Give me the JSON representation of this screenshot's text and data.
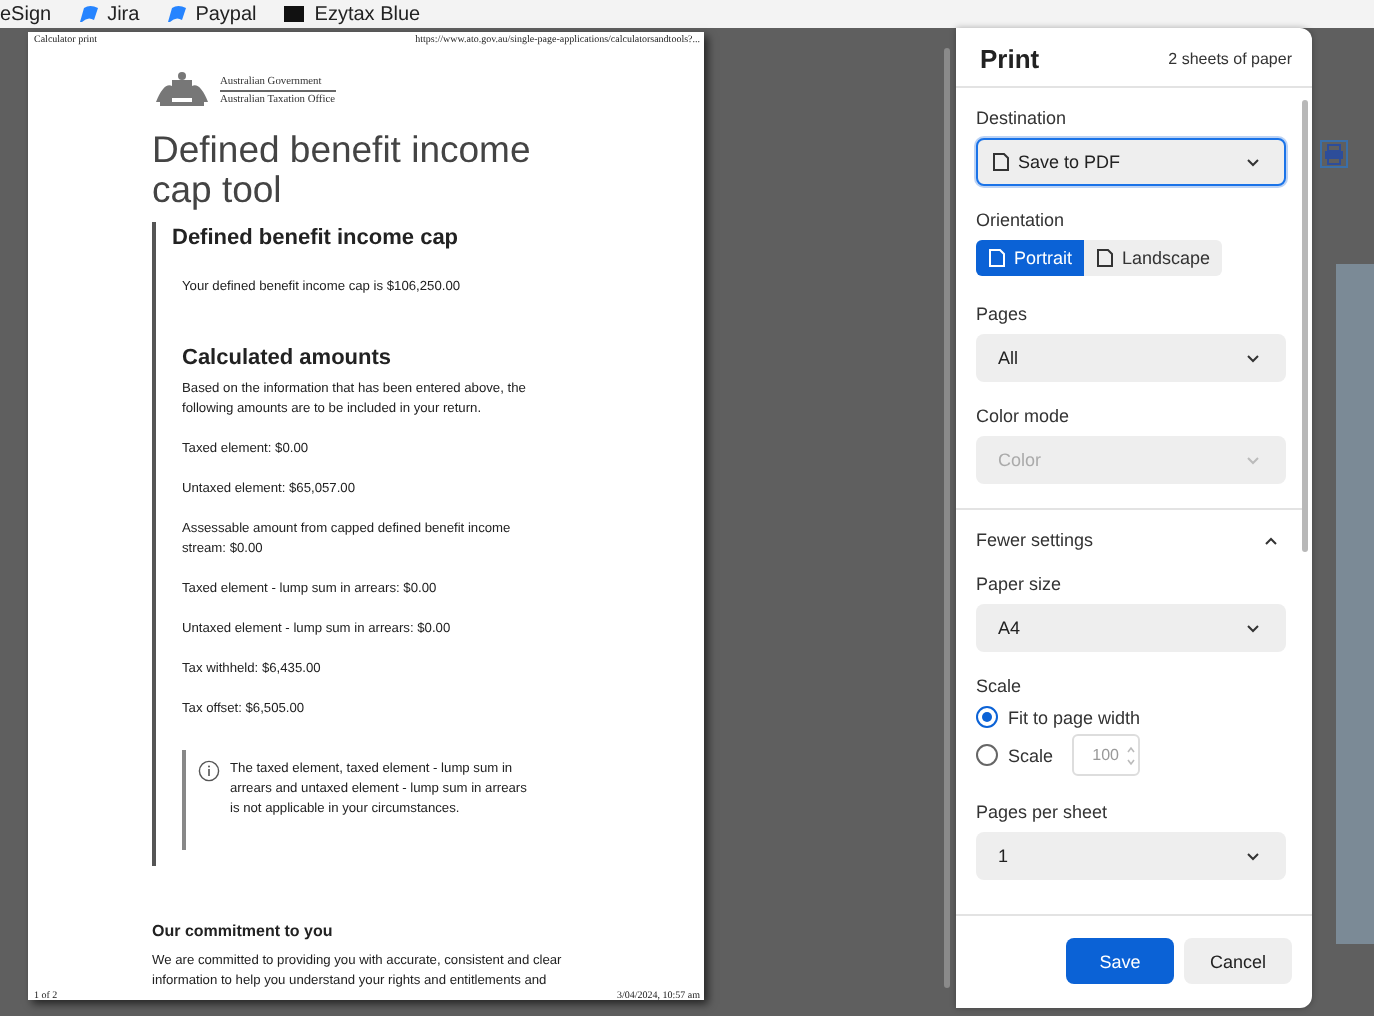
{
  "bookmarks": [
    {
      "label": "eSign",
      "kind": "none"
    },
    {
      "label": "Jira",
      "kind": "flag"
    },
    {
      "label": "Paypal",
      "kind": "flag"
    },
    {
      "label": "Ezytax Blue",
      "kind": "block"
    }
  ],
  "preview": {
    "header_left": "Calculator print",
    "header_right": "https://www.ato.gov.au/single-page-applications/calculatorsandtools?...",
    "logo_lines": [
      "Australian Government",
      "Australian Taxation Office"
    ],
    "title": "Defined benefit income cap tool",
    "section_heading": "Defined benefit income cap",
    "cap_text": "Your defined benefit income cap is $106,250.00",
    "calc_heading": "Calculated amounts",
    "intro": "Based on the information that has been entered above, the following amounts are to be included in your return.",
    "amounts": [
      "Taxed element: $0.00",
      "Untaxed element: $65,057.00",
      "Assessable amount from capped defined benefit income stream: $0.00",
      "Taxed element - lump sum in arrears: $0.00",
      "Untaxed element - lump sum in arrears: $0.00",
      "Tax withheld: $6,435.00",
      "Tax offset: $6,505.00"
    ],
    "note": "The taxed element, taxed element - lump sum in arrears and untaxed element - lump sum in arrears is not applicable in your circumstances.",
    "commitment_heading": "Our commitment to you",
    "commitment_text": "We are committed to providing you with accurate, consistent and clear information to help you understand your rights and entitlements and",
    "footer_left": "1 of 2",
    "footer_right": "3/04/2024, 10:57 am"
  },
  "print_dialog": {
    "title": "Print",
    "sheets": "2 sheets of paper",
    "destination": {
      "label": "Destination",
      "value": "Save to PDF",
      "focused": true
    },
    "orientation": {
      "label": "Orientation",
      "options": [
        {
          "label": "Portrait",
          "selected": true
        },
        {
          "label": "Landscape",
          "selected": false
        }
      ]
    },
    "pages": {
      "label": "Pages",
      "value": "All",
      "disabled": false
    },
    "color_mode": {
      "label": "Color mode",
      "value": "Color",
      "disabled": true
    },
    "more_settings": {
      "label": "Fewer settings",
      "expanded": true
    },
    "paper_size": {
      "label": "Paper size",
      "value": "A4",
      "disabled": false
    },
    "scale": {
      "label": "Scale",
      "options": [
        {
          "label": "Fit to page width",
          "selected": true
        },
        {
          "label": "Scale",
          "selected": false
        }
      ],
      "value": "100"
    },
    "pages_per_sheet": {
      "label": "Pages per sheet",
      "value": "1",
      "disabled": false
    },
    "buttons": [
      {
        "label": "Save",
        "kind": "primary"
      },
      {
        "label": "Cancel",
        "kind": "secondary"
      }
    ]
  }
}
